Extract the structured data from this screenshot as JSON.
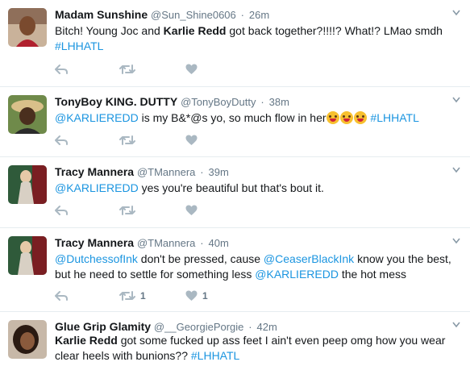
{
  "colors": {
    "link": "#1b95e0",
    "muted": "#657786",
    "icon": "#aab8c2",
    "divider": "#e6ecf0"
  },
  "icons": {
    "reply": "reply-icon",
    "retweet": "retweet-icon",
    "like": "heart-icon",
    "menu": "caret-down-icon"
  },
  "tweets": [
    {
      "name": "Madam Sunshine",
      "handle": "@Sun_Shine0606",
      "dot": "·",
      "time": "26m",
      "text": {
        "p1": "Bitch!  Young Joc and ",
        "p2": "Karlie Redd",
        "p3": " got back together?!!!!?  What!?  LMao smdh ",
        "p4": "#LHHATL"
      }
    },
    {
      "name": "TonyBoy KING. DUTTY",
      "handle": "@TonyBoyDutty",
      "dot": "·",
      "time": "38m",
      "text": {
        "p1": "@KARLIEREDD",
        "p2": " is my B&*@s yo, so much flow in her",
        "p3": " ",
        "p4": "#LHHATL"
      }
    },
    {
      "name": "Tracy Mannera",
      "handle": "@TMannera",
      "dot": "·",
      "time": "39m",
      "text": {
        "p1": "@KARLIEREDD",
        "p2": " yes you're beautiful but that's bout it."
      }
    },
    {
      "name": "Tracy Mannera",
      "handle": "@TMannera",
      "dot": "·",
      "time": "40m",
      "text": {
        "p1": "@DutchessofInk",
        "p2": " don't be pressed, cause ",
        "p3": "@CeaserBlackInk",
        "p4": " know you the best, but he need to settle for something less ",
        "p5": "@KARLIEREDD",
        "p6": "  the hot mess"
      },
      "retweets": "1",
      "likes": "1"
    },
    {
      "name": "Glue Grip Glamity",
      "handle": "@__GeorgiePorgie",
      "dot": "·",
      "time": "42m",
      "text": {
        "p1": "Karlie Redd",
        "p2": " got some fucked up ass feet I ain't even peep omg how you wear clear heels with bunions?? ",
        "p3": "#LHHATL"
      }
    }
  ]
}
